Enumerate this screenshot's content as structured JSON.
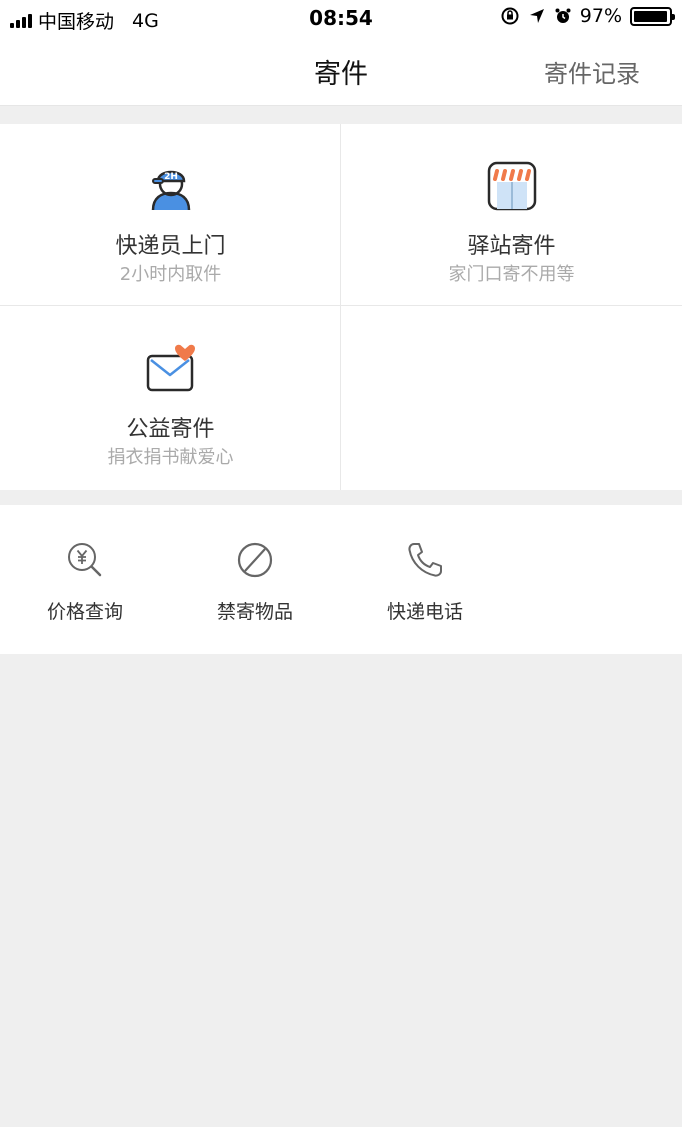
{
  "status_bar": {
    "carrier": "中国移动",
    "network": "4G",
    "time": "08:54",
    "battery_percent": "97%",
    "battery_level": 0.97,
    "icons": [
      "signal-icon",
      "rotation-lock-icon",
      "location-arrow-icon",
      "alarm-icon",
      "battery-icon"
    ]
  },
  "nav": {
    "title": "寄件",
    "action": "寄件记录"
  },
  "services": [
    {
      "title": "快递员上门",
      "subtitle": "2小时内取件",
      "icon": "courier-icon",
      "badge": "2H"
    },
    {
      "title": "驿站寄件",
      "subtitle": "家门口寄不用等",
      "icon": "station-store-icon"
    },
    {
      "title": "公益寄件",
      "subtitle": "捐衣捐书献爱心",
      "icon": "charity-envelope-icon"
    }
  ],
  "tools": [
    {
      "label": "价格查询",
      "icon": "price-search-icon"
    },
    {
      "label": "禁寄物品",
      "icon": "prohibited-icon"
    },
    {
      "label": "快递电话",
      "icon": "phone-icon"
    }
  ],
  "colors": {
    "accent_blue": "#4a90e2",
    "accent_orange": "#f07a4a",
    "background": "#efefef"
  }
}
